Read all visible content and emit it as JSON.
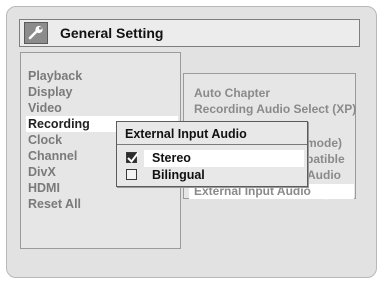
{
  "title": {
    "text": "General Setting",
    "icon": "wrench-icon"
  },
  "menu": {
    "items": [
      {
        "label": "Playback"
      },
      {
        "label": "Display"
      },
      {
        "label": "Video"
      },
      {
        "label": "Recording"
      },
      {
        "label": "Clock"
      },
      {
        "label": "Channel"
      },
      {
        "label": "DivX"
      },
      {
        "label": "HDMI"
      },
      {
        "label": "Reset All"
      }
    ],
    "active": "Recording"
  },
  "submenu": {
    "items": [
      {
        "label": "Auto Chapter"
      },
      {
        "label": "Recording Audio Select (XP)"
      },
      {
        "label": "mode)"
      },
      {
        "label": "patible"
      },
      {
        "label": "Audio"
      },
      {
        "label": "External Input Audio"
      }
    ]
  },
  "popup": {
    "title": "External Input Audio",
    "options": [
      {
        "label": "Stereo",
        "checked": true
      },
      {
        "label": "Bilingual",
        "checked": false
      }
    ]
  },
  "colors": {
    "highlight": "#ffffff",
    "text_dim": "#7a7a7a",
    "background": "#e2e2e2"
  }
}
